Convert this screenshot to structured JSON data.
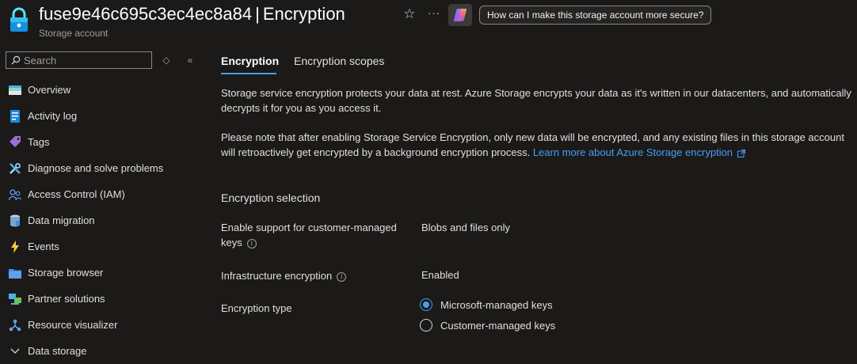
{
  "header": {
    "resource_name": "fuse9e46c695c3ec4ec8a84",
    "separator": "|",
    "page_name": "Encryption",
    "subtitle": "Storage account",
    "copilot_prompt": "How can I make this storage account more secure?",
    "star_glyph": "☆",
    "more_glyph": "···"
  },
  "sidebar": {
    "search_placeholder": "Search",
    "controls": {
      "updown": "◇",
      "collapse": "«"
    },
    "items": [
      {
        "label": "Overview",
        "icon": "overview-icon"
      },
      {
        "label": "Activity log",
        "icon": "activity-log-icon"
      },
      {
        "label": "Tags",
        "icon": "tag-icon"
      },
      {
        "label": "Diagnose and solve problems",
        "icon": "wrench-icon"
      },
      {
        "label": "Access Control (IAM)",
        "icon": "people-icon"
      },
      {
        "label": "Data migration",
        "icon": "data-migration-icon"
      },
      {
        "label": "Events",
        "icon": "lightning-icon"
      },
      {
        "label": "Storage browser",
        "icon": "folder-icon"
      },
      {
        "label": "Partner solutions",
        "icon": "partner-icon"
      },
      {
        "label": "Resource visualizer",
        "icon": "hierarchy-icon"
      },
      {
        "label": "Data storage",
        "icon": "chevron-down-icon"
      }
    ]
  },
  "tabs": [
    {
      "label": "Encryption",
      "active": true
    },
    {
      "label": "Encryption scopes",
      "active": false
    }
  ],
  "content": {
    "para1": "Storage service encryption protects your data at rest. Azure Storage encrypts your data as it's written in our datacenters, and automatically decrypts it for you as you access it.",
    "para2": "Please note that after enabling Storage Service Encryption, only new data will be encrypted, and any existing files in this storage account will retroactively get encrypted by a background encryption process.",
    "learn_more": "Learn more about Azure Storage encryption",
    "section_title": "Encryption selection",
    "cmk_label": "Enable support for customer-managed keys",
    "cmk_value": "Blobs and files only",
    "infra_label": "Infrastructure encryption",
    "infra_value": "Enabled",
    "type_label": "Encryption type",
    "options": [
      {
        "label": "Microsoft-managed keys",
        "selected": true
      },
      {
        "label": "Customer-managed keys",
        "selected": false
      }
    ]
  },
  "colors": {
    "background": "#1b1a19",
    "accent": "#479ef5",
    "text": "#e1dfdd"
  }
}
